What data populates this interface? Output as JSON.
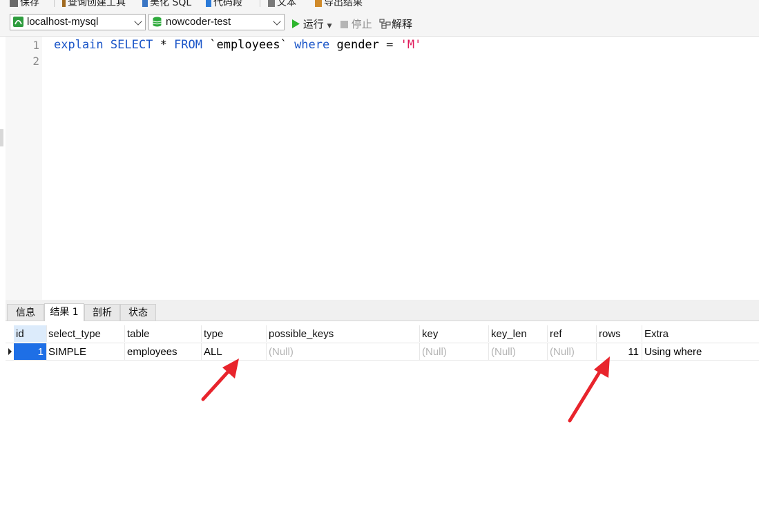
{
  "top_toolbar": {
    "items": [
      "保存",
      "查询创建工具",
      "美化 SQL",
      "代码段",
      "文本",
      "导出结果"
    ]
  },
  "connection_bar": {
    "connection": "localhost-mysql",
    "database": "nowcoder-test",
    "run_label": "运行",
    "stop_label": "停止",
    "explain_label": "解释"
  },
  "editor": {
    "line_numbers": [
      "1",
      "2"
    ],
    "code": {
      "kw1": "explain",
      "kw2": "SELECT",
      "star": " * ",
      "kw3": "FROM",
      "table": " `employees` ",
      "kw4": "where",
      "cond": " gender = ",
      "value": "'M'"
    }
  },
  "result_tabs": [
    "信息",
    "结果 1",
    "剖析",
    "状态"
  ],
  "grid": {
    "columns": [
      "id",
      "select_type",
      "table",
      "type",
      "possible_keys",
      "key",
      "key_len",
      "ref",
      "rows",
      "Extra"
    ],
    "row": {
      "id": "1",
      "select_type": "SIMPLE",
      "table": "employees",
      "type": "ALL",
      "possible_keys": "(Null)",
      "key": "(Null)",
      "key_len": "(Null)",
      "ref": "(Null)",
      "rows": "11",
      "extra": "Using where"
    }
  },
  "colors": {
    "accent": "#1e6fe6",
    "keyword": "#1a55c8",
    "string": "#e0195a",
    "annotation_arrow": "#e8242c",
    "run_green": "#2db52d"
  }
}
